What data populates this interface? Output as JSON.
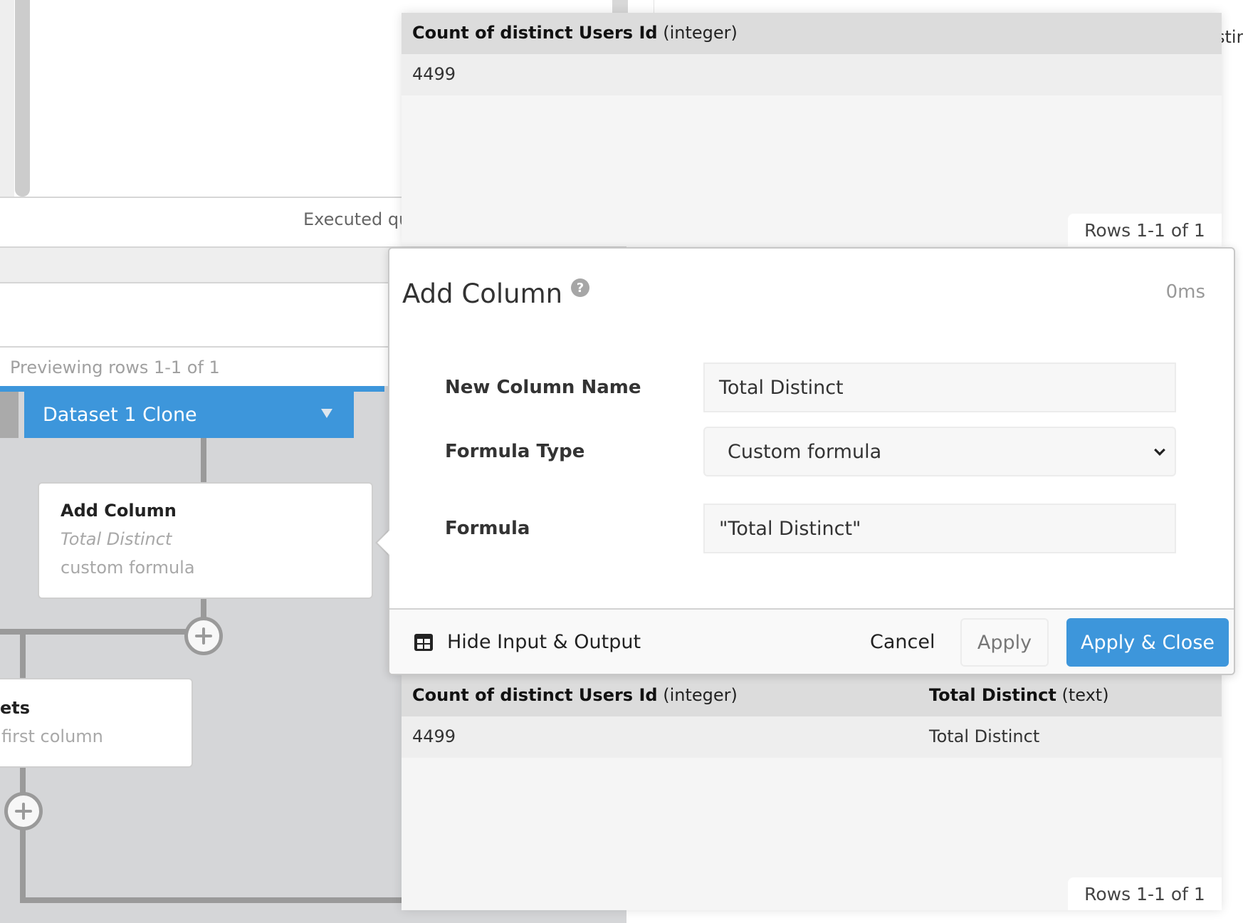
{
  "editor": {
    "executed_text": "Executed qu",
    "previewing_text": "Previewing rows 1-1 of 1"
  },
  "flow": {
    "dataset_tab_label": "Dataset 1 Clone",
    "steps": [
      {
        "title": "Add Column",
        "subtitle": "Total Distinct",
        "detail": "custom formula"
      },
      {
        "title": "ets",
        "detail": "first column"
      }
    ]
  },
  "input_table": {
    "columns": [
      {
        "name": "Count of distinct Users Id",
        "type": "(integer)"
      }
    ],
    "rows": [
      [
        "4499"
      ]
    ],
    "rows_count": "Rows 1-1 of 1"
  },
  "right_edge_text": "stin",
  "modal": {
    "title": "Add Column",
    "timing": "0ms",
    "fields": {
      "new_column_name": {
        "label": "New Column Name",
        "value": "Total Distinct"
      },
      "formula_type": {
        "label": "Formula Type",
        "value": "Custom formula"
      },
      "formula": {
        "label": "Formula",
        "value": "\"Total Distinct\""
      }
    },
    "footer": {
      "hide_io_label": "Hide Input & Output",
      "cancel_label": "Cancel",
      "apply_label": "Apply",
      "apply_close_label": "Apply & Close"
    },
    "colors": {
      "primary": "#3d96db"
    }
  },
  "output_table": {
    "columns": [
      {
        "name": "Count of distinct Users Id",
        "type": "(integer)"
      },
      {
        "name": "Total Distinct",
        "type": "(text)"
      }
    ],
    "rows": [
      [
        "4499",
        "Total Distinct"
      ]
    ],
    "rows_count": "Rows 1-1 of 1"
  }
}
